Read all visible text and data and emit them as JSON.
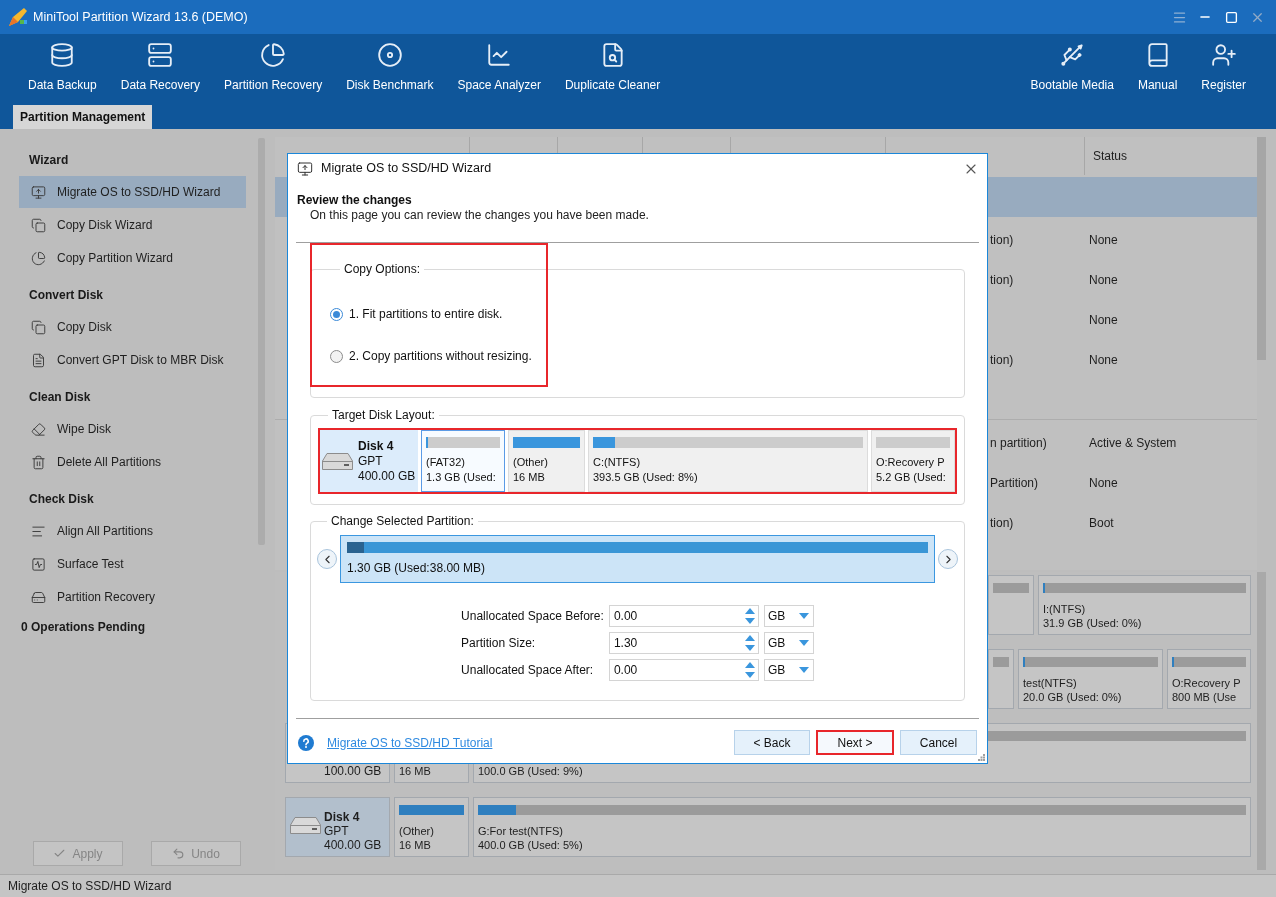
{
  "window": {
    "title": "MiniTool Partition Wizard 13.6 (DEMO)"
  },
  "toolbar": {
    "left": [
      {
        "label": "Data Backup",
        "kind": "backup"
      },
      {
        "label": "Data Recovery",
        "kind": "data_recovery"
      },
      {
        "label": "Partition Recovery",
        "kind": "partition_recovery"
      },
      {
        "label": "Disk Benchmark",
        "kind": "benchmark"
      },
      {
        "label": "Space Analyzer",
        "kind": "analyzer"
      },
      {
        "label": "Duplicate Cleaner",
        "kind": "duplicate"
      }
    ],
    "right": [
      {
        "label": "Bootable Media",
        "kind": "bootable"
      },
      {
        "label": "Manual",
        "kind": "manual"
      },
      {
        "label": "Register",
        "kind": "register"
      }
    ]
  },
  "tabs": [
    {
      "label": "Partition Management",
      "selected": true
    }
  ],
  "sidebar": {
    "sections": [
      {
        "title": "Wizard",
        "items": [
          {
            "label": "Migrate OS to SSD/HD Wizard",
            "kind": "migrate",
            "selected": true
          },
          {
            "label": "Copy Disk Wizard",
            "kind": "copy_disk",
            "selected": false
          },
          {
            "label": "Copy Partition Wizard",
            "kind": "copy_partition",
            "selected": false
          }
        ]
      },
      {
        "title": "Convert Disk",
        "items": [
          {
            "label": "Copy Disk",
            "kind": "copy_disk",
            "selected": false
          },
          {
            "label": "Convert GPT Disk to MBR Disk",
            "kind": "convert",
            "selected": false
          }
        ]
      },
      {
        "title": "Clean Disk",
        "items": [
          {
            "label": "Wipe Disk",
            "kind": "wipe",
            "selected": false
          },
          {
            "label": "Delete All Partitions",
            "kind": "delete",
            "selected": false
          }
        ]
      },
      {
        "title": "Check Disk",
        "items": [
          {
            "label": "Align All Partitions",
            "kind": "align",
            "selected": false
          },
          {
            "label": "Surface Test",
            "kind": "surface",
            "selected": false
          },
          {
            "label": "Partition Recovery",
            "kind": "recover",
            "selected": false
          }
        ]
      }
    ],
    "pending": "0 Operations Pending",
    "buttons": [
      {
        "label": "Apply",
        "kind": "apply",
        "disabled": true
      },
      {
        "label": "Undo",
        "kind": "undo",
        "disabled": true
      }
    ]
  },
  "partition_table": {
    "heading": "Status",
    "groups": [
      {
        "header_selected": true,
        "rows": [
          {
            "column_6": "tion)",
            "status": "None"
          },
          {
            "column_6": "tion)",
            "status": "None"
          },
          {
            "status": "None"
          },
          {
            "column_6": "tion)",
            "status": "None"
          }
        ]
      },
      {
        "header_selected": false,
        "rows": [
          {
            "column_6": "n partition)",
            "status": "Active & System"
          },
          {
            "column_6": "Partition)",
            "status": "None"
          },
          {
            "column_6": "tion)",
            "status": "Boot"
          }
        ]
      }
    ]
  },
  "disk_map": [
    {
      "partitions": [
        {
          "kind": "track"
        },
        {
          "kind": "full",
          "label": "I:(NTFS)",
          "size": "31.9 GB (Used: 0%)",
          "level": 0.01
        }
      ]
    },
    {
      "partitions": [
        {
          "kind": "track"
        },
        {
          "kind": "full",
          "label": "test(NTFS)",
          "size": "20.0 GB (Used: 0%)",
          "level": 0.015
        },
        {
          "kind": "full",
          "label": "O:Recovery P",
          "size": "800 MB (Use",
          "level": 0.03
        }
      ]
    },
    {
      "disk": {
        "size": "100.00 GB",
        "selected": false
      },
      "partitions": [
        {
          "kind": "plain",
          "size": "16 MB"
        },
        {
          "kind": "track",
          "size": "100.0 GB (Used: 9%)"
        }
      ]
    },
    {
      "disk": {
        "name": "Disk 4",
        "style": "GPT",
        "size": "400.00 GB",
        "selected": true
      },
      "partitions": [
        {
          "kind": "full",
          "label": "(Other)",
          "size": "16 MB",
          "level": 1
        },
        {
          "kind": "full",
          "label": "G:For test(NTFS)",
          "size": "400.0 GB (Used: 5%)",
          "level": 0.05
        }
      ]
    }
  ],
  "dialog": {
    "title": "Migrate OS to SSD/HD Wizard",
    "heading": "Review the changes",
    "description": "On this page you can review the changes you have been made.",
    "copy_options": {
      "legend": "Copy Options:",
      "highlighted": true,
      "options": [
        {
          "label": "1. Fit partitions to entire disk.",
          "selected": true
        },
        {
          "label": "2. Copy partitions without resizing.",
          "selected": false
        }
      ]
    },
    "target_layout": {
      "legend": "Target Disk Layout:",
      "highlighted": true,
      "disk": {
        "name": "Disk 4",
        "style": "GPT",
        "size": "400.00 GB"
      },
      "partitions": [
        {
          "label": "(FAT32)",
          "size": "1.3 GB (Used:",
          "level": 0.03,
          "selected": true
        },
        {
          "label": "(Other)",
          "size": "16 MB",
          "level": 1,
          "selected": false
        },
        {
          "label": "C:(NTFS)",
          "size": "393.5 GB (Used: 8%)",
          "level": 0.08,
          "selected": false
        },
        {
          "label": "O:Recovery P",
          "size": "5.2 GB (Used:",
          "selected": false
        }
      ]
    },
    "change_partition": {
      "legend": "Change Selected Partition:",
      "summary": "1.30 GB (Used:38.00 MB)",
      "level": 0.03,
      "fields": [
        {
          "label": "Unallocated Space Before:",
          "value": "0.00",
          "unit": "GB"
        },
        {
          "label": "Partition Size:",
          "value": "1.30",
          "unit": "GB"
        },
        {
          "label": "Unallocated Space After:",
          "value": "0.00",
          "unit": "GB"
        }
      ]
    },
    "help_link": "Migrate OS to SSD/HD Tutorial",
    "buttons": [
      {
        "label": "< Back",
        "highlighted": false
      },
      {
        "label": "Next >",
        "highlighted": true
      },
      {
        "label": "Cancel",
        "highlighted": false
      }
    ]
  },
  "status_bar": "Migrate OS to SSD/HD Wizard"
}
